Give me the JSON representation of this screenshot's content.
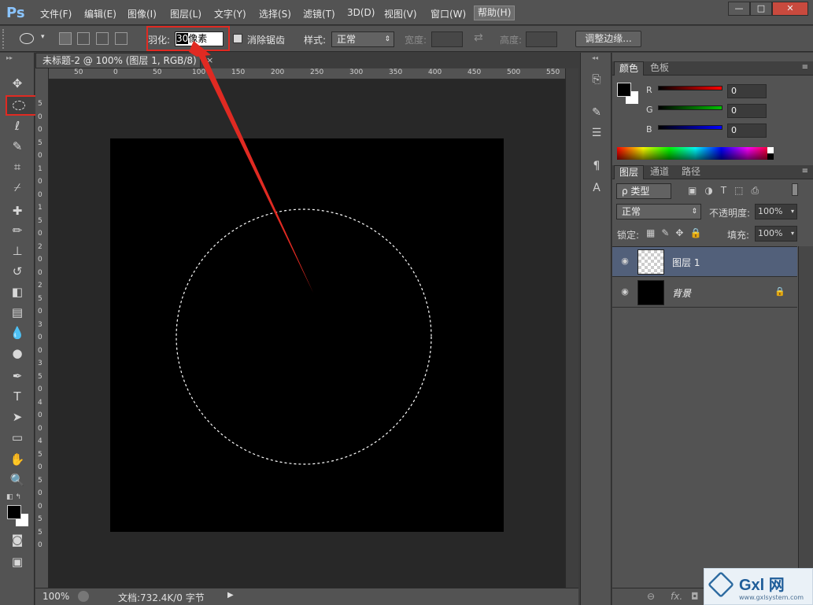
{
  "app": {
    "logo": "Ps"
  },
  "menu": {
    "items": [
      "文件(F)",
      "编辑(E)",
      "图像(I)",
      "图层(L)",
      "文字(Y)",
      "选择(S)",
      "滤镜(T)",
      "3D(D)",
      "视图(V)",
      "窗口(W)",
      "帮助(H)"
    ]
  },
  "window_controls": {
    "minimize": "—",
    "restore": "□",
    "close": "✕"
  },
  "options": {
    "feather_label": "羽化:",
    "feather_value": "30",
    "feather_unit": "像素",
    "antialias_label": "消除锯齿",
    "style_label": "样式:",
    "style_value": "正常",
    "width_label": "宽度:",
    "height_label": "高度:",
    "refine_edge": "调整边缘..."
  },
  "document": {
    "tab_title": "未标题-2 @ 100% (图层 1, RGB/8) *",
    "ruler_top": [
      "50",
      "0",
      "50",
      "100",
      "150",
      "200",
      "250",
      "300",
      "350",
      "400",
      "450",
      "500",
      "550"
    ],
    "ruler_left": [
      "5",
      "0",
      "0",
      "5",
      "0",
      "1",
      "0",
      "0",
      "1",
      "5",
      "0",
      "2",
      "0",
      "0",
      "2",
      "5",
      "0",
      "3",
      "0",
      "0",
      "3",
      "5",
      "0",
      "4",
      "0",
      "0",
      "4",
      "5",
      "0",
      "5",
      "0",
      "0",
      "5",
      "5",
      "0"
    ]
  },
  "status": {
    "zoom": "100%",
    "doc_info": "文档:732.4K/0 字节"
  },
  "color_panel": {
    "tabs": [
      "颜色",
      "色板"
    ],
    "channels": [
      {
        "label": "R",
        "value": "0",
        "color": "#ff0000"
      },
      {
        "label": "G",
        "value": "0",
        "color": "#00c000"
      },
      {
        "label": "B",
        "value": "0",
        "color": "#0000ff"
      }
    ]
  },
  "layers_panel": {
    "tabs": [
      "图层",
      "通道",
      "路径"
    ],
    "filter_kind": "ρ 类型",
    "blend_mode": "正常",
    "opacity_label": "不透明度:",
    "opacity_value": "100%",
    "lock_label": "锁定:",
    "fill_label": "填充:",
    "fill_value": "100%",
    "layers": [
      {
        "name": "图层 1",
        "selected": true
      },
      {
        "name": "背景",
        "selected": false,
        "locked": true
      }
    ]
  },
  "watermark": {
    "text": "Gxl 网",
    "url": "www.gxlsystem.com"
  },
  "colors": {
    "accent_red": "#e02a22",
    "selection_row": "#52607a"
  }
}
